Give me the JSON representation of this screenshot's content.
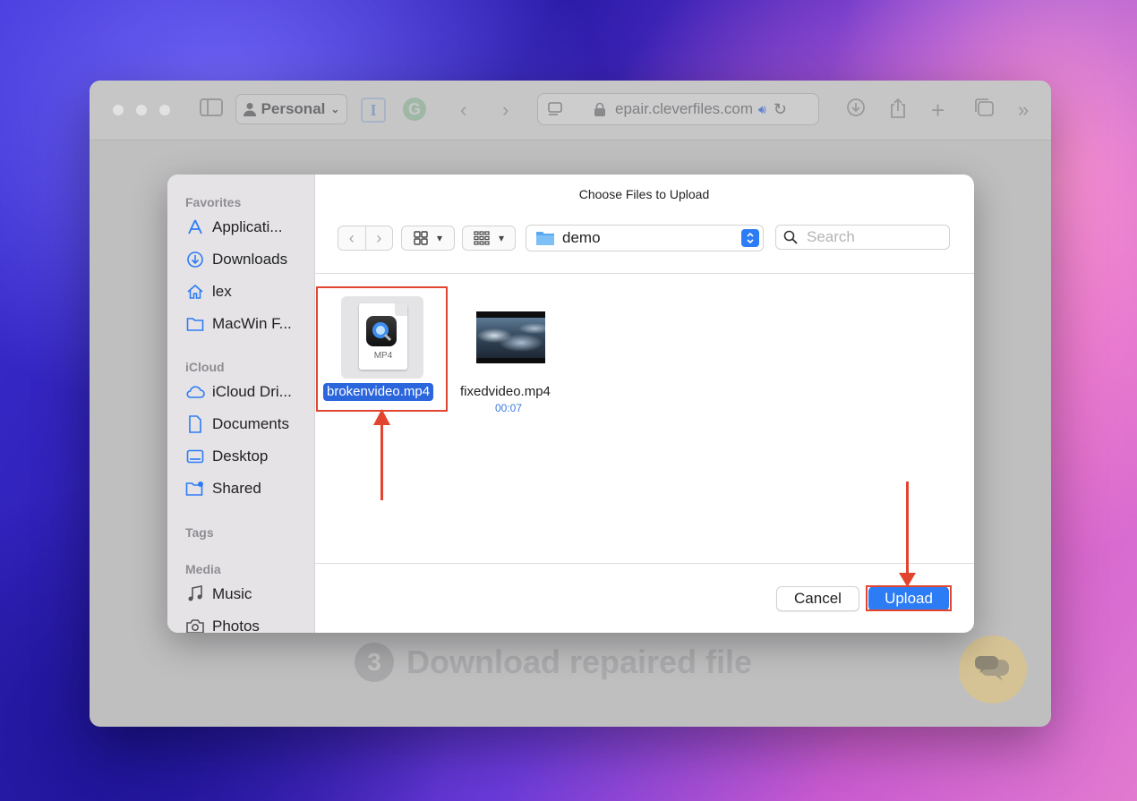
{
  "browser": {
    "profile_label": "Personal",
    "url": "epair.cleverfiles.com"
  },
  "page": {
    "step_number": "3",
    "step_text": "Download repaired file"
  },
  "dialog": {
    "title": "Choose Files to Upload",
    "current_folder": "demo",
    "search_placeholder": "Search",
    "cancel_label": "Cancel",
    "upload_label": "Upload"
  },
  "sidebar": {
    "sections": [
      {
        "label": "Favorites",
        "items": [
          {
            "label": "Applicati...",
            "icon": "applications-icon"
          },
          {
            "label": "Downloads",
            "icon": "downloads-icon"
          },
          {
            "label": "lex",
            "icon": "home-icon"
          },
          {
            "label": "MacWin F...",
            "icon": "folder-icon"
          }
        ]
      },
      {
        "label": "iCloud",
        "items": [
          {
            "label": "iCloud Dri...",
            "icon": "cloud-icon"
          },
          {
            "label": "Documents",
            "icon": "document-icon"
          },
          {
            "label": "Desktop",
            "icon": "desktop-icon"
          },
          {
            "label": "Shared",
            "icon": "shared-folder-icon"
          }
        ]
      },
      {
        "label": "Tags",
        "items": []
      },
      {
        "label": "Media",
        "items": [
          {
            "label": "Music",
            "icon": "music-icon"
          },
          {
            "label": "Photos",
            "icon": "camera-icon"
          }
        ]
      }
    ]
  },
  "files": [
    {
      "name": "brokenvideo.mp4",
      "type_label": "MP4",
      "selected": true
    },
    {
      "name": "fixedvideo.mp4",
      "duration": "00:07",
      "selected": false
    }
  ],
  "colors": {
    "accent": "#2c7cf5",
    "selection": "#2c66dc",
    "annotation": "#e2452f"
  }
}
